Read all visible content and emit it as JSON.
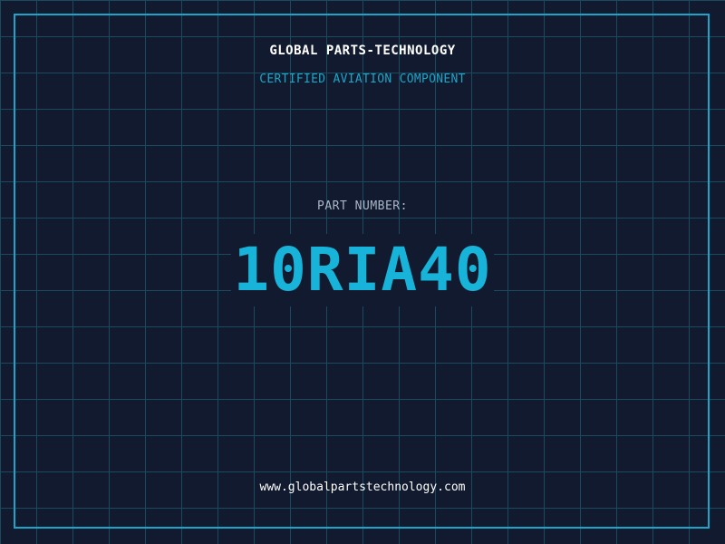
{
  "header": {
    "company_name": "GLOBAL PARTS-TECHNOLOGY",
    "certification": "CERTIFIED AVIATION COMPONENT"
  },
  "part": {
    "label": "PART NUMBER:",
    "number": "10RIA40"
  },
  "footer": {
    "website": "www.globalpartstechnology.com"
  },
  "colors": {
    "background": "#111a2e",
    "grid": "#1a4a5e",
    "accent": "#1aa6c9",
    "part_number": "#17b3d9"
  }
}
